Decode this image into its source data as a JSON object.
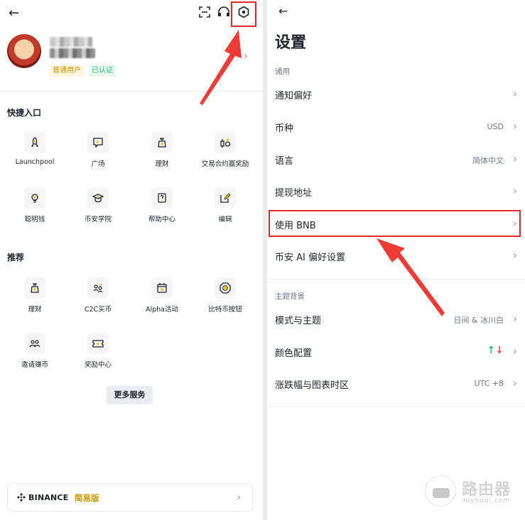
{
  "left": {
    "back_icon": "arrow-left-icon",
    "top_icons": [
      "scan-icon",
      "headset-icon",
      "settings-hex-icon"
    ],
    "profile": {
      "badge_user": "普通用户",
      "badge_verified": "已认证"
    },
    "quick_access": {
      "title": "快捷入口",
      "items": [
        {
          "label": "Launchpool",
          "icon": "rocket-icon"
        },
        {
          "label": "广场",
          "icon": "square-chat-icon"
        },
        {
          "label": "理财",
          "icon": "moneybag-icon"
        },
        {
          "label": "交易合约赢奖励",
          "icon": "futures-reward-icon"
        },
        {
          "label": "聪明钱",
          "icon": "lightbulb-icon"
        },
        {
          "label": "币安学院",
          "icon": "graduation-cap-icon"
        },
        {
          "label": "帮助中心",
          "icon": "help-book-icon"
        },
        {
          "label": "编辑",
          "icon": "edit-icon"
        }
      ]
    },
    "recommended": {
      "title": "推荐",
      "items": [
        {
          "label": "理财",
          "icon": "moneybag-icon"
        },
        {
          "label": "C2C买币",
          "icon": "c2c-users-icon"
        },
        {
          "label": "Alpha活动",
          "icon": "alpha-calendar-icon"
        },
        {
          "label": "比特币按钮",
          "icon": "bitcoin-button-icon"
        },
        {
          "label": "邀请赚币",
          "icon": "invite-users-icon"
        },
        {
          "label": "奖励中心",
          "icon": "ticket-icon"
        }
      ]
    },
    "more_services": "更多服务",
    "lite": {
      "brand": "BINANCE",
      "mode": "简易版"
    }
  },
  "right": {
    "back_icon": "arrow-left-icon",
    "title": "设置",
    "general": {
      "header": "通用",
      "rows": [
        {
          "label": "通知偏好",
          "value": ""
        },
        {
          "label": "币种",
          "value": "USD"
        },
        {
          "label": "语言",
          "value": "简体中文"
        },
        {
          "label": "提现地址",
          "value": ""
        },
        {
          "label": "使用 BNB",
          "value": ""
        },
        {
          "label": "币安 AI 偏好设置",
          "value": ""
        }
      ]
    },
    "theme": {
      "header": "主题背景",
      "rows": [
        {
          "label": "模式与主题",
          "value": "日间 & 冰川白"
        },
        {
          "label": "颜色配置",
          "value": ""
        },
        {
          "label": "涨跌幅与图表时区",
          "value": "UTC +8"
        }
      ]
    }
  },
  "watermark": {
    "title": "路由器",
    "url": "luyouqi.com"
  },
  "colors": {
    "accent": "#f0b90b",
    "highlight_red": "#e3292b",
    "up_green": "#2ebd85",
    "down_red": "#f6465d"
  }
}
